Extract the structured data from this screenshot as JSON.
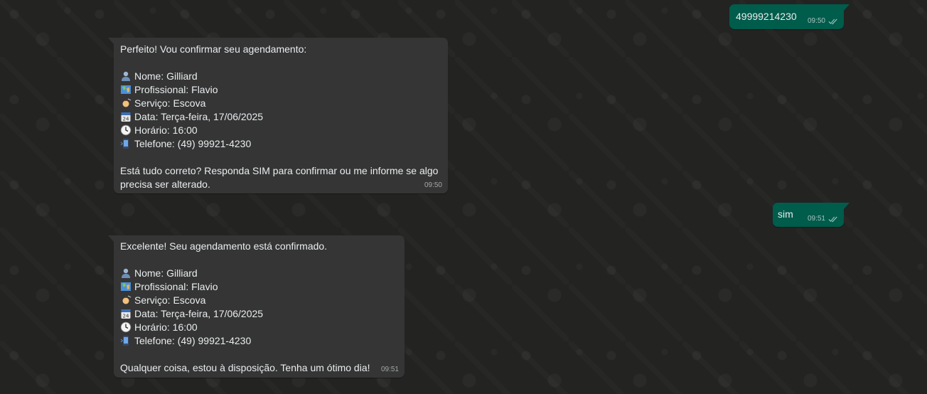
{
  "messages": [
    {
      "id": "out-1",
      "direction": "outgoing",
      "text": "49999214230",
      "time": "09:50",
      "status": "read"
    },
    {
      "id": "in-1",
      "direction": "incoming",
      "lines": [
        {
          "emoji": null,
          "text": "Perfeito! Vou confirmar seu agendamento:"
        },
        {
          "emoji": null,
          "text": ""
        },
        {
          "emoji": "bust-in-silhouette-icon",
          "text": "Nome: Gilliard"
        },
        {
          "emoji": "world-map-icon",
          "text": "Profissional: Flavio"
        },
        {
          "emoji": "haircut-icon",
          "text": "Serviço: Escova"
        },
        {
          "emoji": "calendar-icon",
          "text": "Data: Terça-feira, 17/06/2025"
        },
        {
          "emoji": "clock-icon",
          "text": "Horário: 16:00"
        },
        {
          "emoji": "mobile-phone-icon",
          "text": "Telefone: (49) 99921-4230"
        },
        {
          "emoji": null,
          "text": ""
        },
        {
          "emoji": null,
          "text": "Está tudo correto? Responda SIM para confirmar ou me informe se algo"
        },
        {
          "emoji": null,
          "text": "precisa ser alterado."
        }
      ],
      "time": "09:50"
    },
    {
      "id": "out-2",
      "direction": "outgoing",
      "text": "sim",
      "time": "09:51",
      "status": "read"
    },
    {
      "id": "in-2",
      "direction": "incoming",
      "lines": [
        {
          "emoji": null,
          "text": "Excelente! Seu agendamento está confirmado."
        },
        {
          "emoji": null,
          "text": ""
        },
        {
          "emoji": "bust-in-silhouette-icon",
          "text": "Nome: Gilliard"
        },
        {
          "emoji": "world-map-icon",
          "text": "Profissional: Flavio"
        },
        {
          "emoji": "haircut-icon",
          "text": "Serviço: Escova"
        },
        {
          "emoji": "calendar-icon",
          "text": "Data: Terça-feira, 17/06/2025"
        },
        {
          "emoji": "clock-icon",
          "text": "Horário: 16:00"
        },
        {
          "emoji": "mobile-phone-icon",
          "text": "Telefone: (49) 99921-4230"
        },
        {
          "emoji": null,
          "text": ""
        },
        {
          "emoji": null,
          "text": "Qualquer coisa, estou à disposição. Tenha um ótimo dia!"
        }
      ],
      "time": "09:51"
    }
  ],
  "colors": {
    "background": "#232322",
    "incoming_bubble": "#353535",
    "outgoing_bubble": "#005c4b",
    "text": "#e9edef"
  }
}
